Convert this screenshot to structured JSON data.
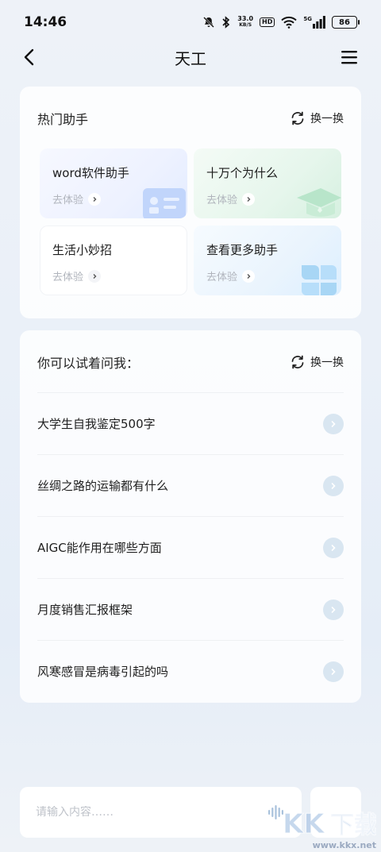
{
  "status_bar": {
    "time": "14:46",
    "net_speed_value": "33.0",
    "net_speed_unit": "KB/S",
    "hd_label": "HD",
    "network_label": "5G",
    "battery": "86"
  },
  "header": {
    "title": "天工"
  },
  "hot_assistants": {
    "title": "热门助手",
    "refresh_label": "换一换",
    "tiles": [
      {
        "title": "word软件助手",
        "subtitle": "去体验"
      },
      {
        "title": "十万个为什么",
        "subtitle": "去体验"
      },
      {
        "title": "生活小妙招",
        "subtitle": "去体验"
      },
      {
        "title": "查看更多助手",
        "subtitle": "去体验"
      }
    ]
  },
  "ask_me": {
    "title": "你可以试着问我：",
    "refresh_label": "换一换",
    "items": [
      {
        "text": "大学生自我鉴定500字"
      },
      {
        "text": "丝绸之路的运输都有什么"
      },
      {
        "text": "AIGC能作用在哪些方面"
      },
      {
        "text": "月度销售汇报框架"
      },
      {
        "text": "风寒感冒是病毒引起的吗"
      }
    ]
  },
  "input": {
    "placeholder": "请输入内容……",
    "value": ""
  },
  "watermark": {
    "logo_text": "KK下载",
    "url": "www.kkx.net"
  },
  "colors": {
    "accent_soft": "#d9e6f1",
    "hint_gray": "#b0b4bc"
  }
}
